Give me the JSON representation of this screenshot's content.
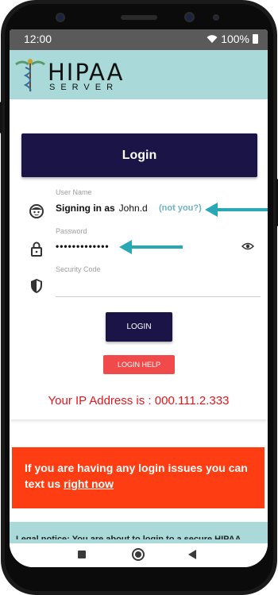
{
  "status_bar": {
    "time": "12:00",
    "battery": "100%"
  },
  "header": {
    "logo_title": "HIPAA",
    "logo_subtitle": "SERVER"
  },
  "login_card": {
    "banner": "Login",
    "username_label": "User Name",
    "signing_in_as": "Signing in as",
    "username_value": "John.d",
    "not_you": "(not you?)",
    "password_label": "Password",
    "password_value": "•••••••••••••",
    "security_label": "Security Code",
    "login_button": "LOGIN",
    "help_button": "LOGIN HELP",
    "ip_text": "Your IP Address is : 000.111.2.333"
  },
  "alert": {
    "text": "If you are having any login issues you can text us ",
    "link": "right now"
  },
  "legal": {
    "text": "Legal notice: You are about to login to a secure HIPAA"
  },
  "colors": {
    "header_bg": "#a9d9d9",
    "primary": "#1a1447",
    "danger": "#f04a4a",
    "alert_bg": "#ff3d12",
    "ip": "#e8131a",
    "annotation_arrow": "#27a8b3"
  },
  "icons": [
    "caduceus-icon",
    "wifi-icon",
    "battery-icon",
    "user-face-icon",
    "lock-icon",
    "shield-icon",
    "eye-icon",
    "recents-icon",
    "home-icon",
    "back-icon"
  ]
}
